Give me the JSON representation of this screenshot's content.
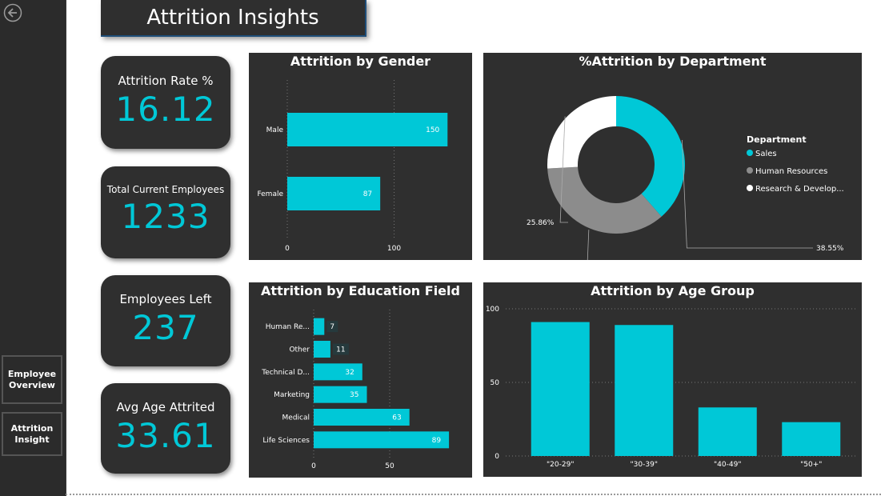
{
  "header": {
    "title": "Attrition Insights"
  },
  "sidebar": {
    "items": [
      {
        "label": "Employee Overview"
      },
      {
        "label": "Attrition Insight"
      }
    ]
  },
  "kpis": [
    {
      "label": "Attrition Rate %",
      "value": "16.12"
    },
    {
      "label": "Total Current Employees",
      "value": "1233"
    },
    {
      "label": "Employees Left",
      "value": "237"
    },
    {
      "label": "Avg Age Attrited",
      "value": "33.61"
    }
  ],
  "colors": {
    "accent": "#00c8d7",
    "panel": "#2f2f2f",
    "gray": "#8c8c8c",
    "white": "#ffffff"
  },
  "chart_data": [
    {
      "type": "bar",
      "title": "Attrition by Gender",
      "orientation": "horizontal",
      "categories": [
        "Male",
        "Female"
      ],
      "values": [
        150,
        87
      ],
      "xlim": [
        0,
        170
      ],
      "xticks": [
        0,
        100
      ]
    },
    {
      "type": "pie",
      "donut": true,
      "title": "%Attrition by Department",
      "legend_title": "Department",
      "legend_position": "right",
      "categories": [
        "Sales",
        "Human Resources",
        "Research & Develop..."
      ],
      "values": [
        38.55,
        35.59,
        25.86
      ],
      "labels": [
        "38.55%",
        "35.59%",
        "25.86%"
      ],
      "colors": [
        "#00c8d7",
        "#8c8c8c",
        "#ffffff"
      ]
    },
    {
      "type": "bar",
      "title": "Attrition by Education Field",
      "orientation": "horizontal",
      "categories": [
        "Human Re...",
        "Other",
        "Technical D...",
        "Marketing",
        "Medical",
        "Life Sciences"
      ],
      "values": [
        7,
        11,
        32,
        35,
        63,
        89
      ],
      "xlim": [
        0,
        100
      ],
      "xticks": [
        0,
        50
      ]
    },
    {
      "type": "bar",
      "title": "Attrition by Age Group",
      "categories": [
        "\"20-29\"",
        "\"30-39\"",
        "\"40-49\"",
        "\"50+\""
      ],
      "values": [
        91,
        89,
        33,
        23
      ],
      "ylim": [
        0,
        100
      ],
      "yticks": [
        0,
        50,
        100
      ],
      "grid": true
    }
  ]
}
